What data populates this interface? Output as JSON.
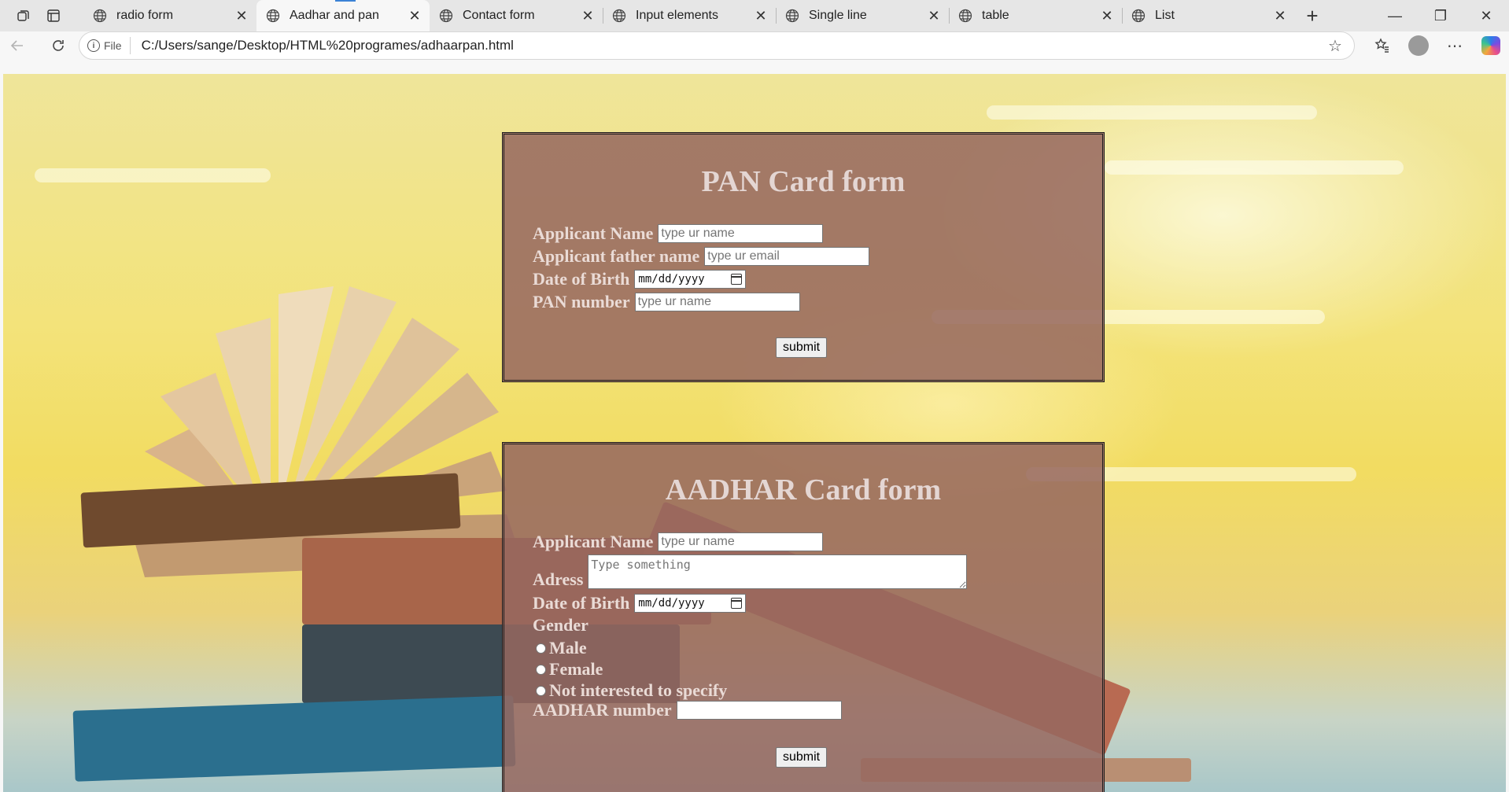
{
  "browser": {
    "tabs": [
      {
        "label": "radio form"
      },
      {
        "label": "Aadhar and pan"
      },
      {
        "label": "Contact form"
      },
      {
        "label": "Input elements"
      },
      {
        "label": "Single line"
      },
      {
        "label": "table"
      },
      {
        "label": "List"
      }
    ],
    "active_tab": 1,
    "omnibox": {
      "scheme_chip": "File",
      "url": "C:/Users/sange/Desktop/HTML%20programes/adhaarpan.html"
    }
  },
  "pan_form": {
    "title": "PAN Card form",
    "fields": {
      "name": {
        "label": "Applicant Name",
        "placeholder": "type ur name"
      },
      "father": {
        "label": "Applicant father name",
        "placeholder": "type ur email"
      },
      "dob": {
        "label": "Date of Birth",
        "value": "mm/dd/yyyy"
      },
      "pan": {
        "label": "PAN number",
        "placeholder": "type ur name"
      }
    },
    "submit": "submit"
  },
  "aadhar_form": {
    "title": "AADHAR Card form",
    "fields": {
      "name": {
        "label": "Applicant Name",
        "placeholder": "type ur name"
      },
      "address": {
        "label": "Adress",
        "placeholder": "Type something"
      },
      "dob": {
        "label": "Date of Birth",
        "value": "mm/dd/yyyy"
      },
      "gender": {
        "label": "Gender",
        "options": [
          "Male",
          "Female",
          "Not interested to specify"
        ]
      },
      "aadhar": {
        "label": "AADHAR number",
        "placeholder": ""
      }
    },
    "submit": "submit"
  }
}
